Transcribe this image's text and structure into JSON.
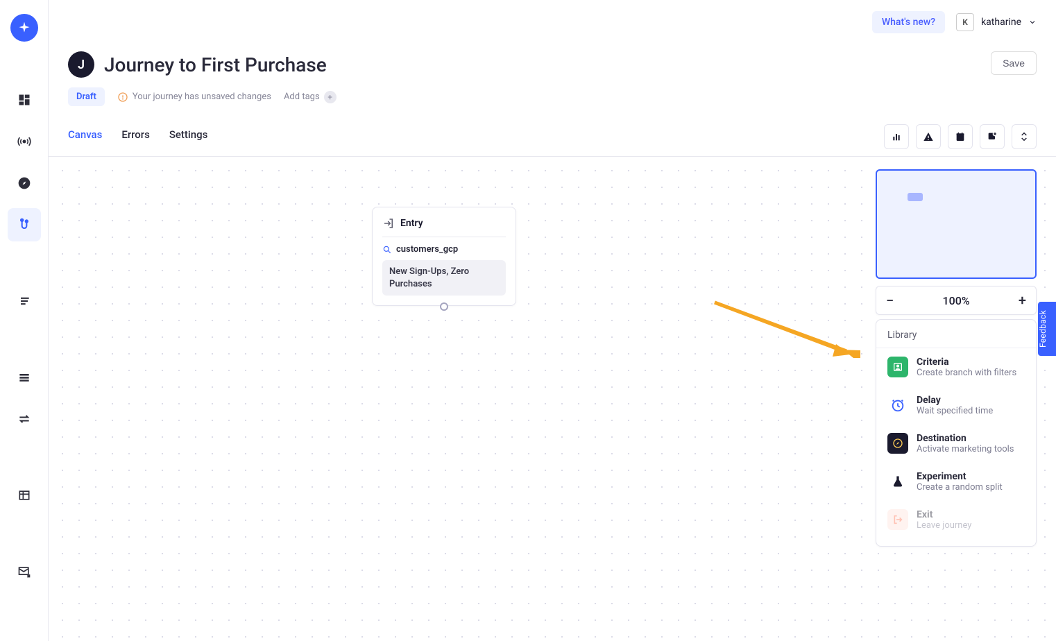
{
  "header": {
    "whats_new": "What's new?",
    "user_initial": "K",
    "user_name": "katharine"
  },
  "page": {
    "title_letter": "J",
    "title": "Journey to First Purchase",
    "save_label": "Save",
    "status": "Draft",
    "warning": "Your journey has unsaved changes",
    "add_tags": "Add tags"
  },
  "tabs": {
    "items": [
      "Canvas",
      "Errors",
      "Settings"
    ],
    "active_index": 0
  },
  "entry_node": {
    "title": "Entry",
    "source": "customers_gcp",
    "segment": "New Sign-Ups, Zero Purchases"
  },
  "zoom": {
    "value": "100%"
  },
  "library": {
    "title": "Library",
    "items": [
      {
        "name": "Criteria",
        "desc": "Create branch with filters"
      },
      {
        "name": "Delay",
        "desc": "Wait specified time"
      },
      {
        "name": "Destination",
        "desc": "Activate marketing tools"
      },
      {
        "name": "Experiment",
        "desc": "Create a random split"
      },
      {
        "name": "Exit",
        "desc": "Leave journey"
      }
    ]
  },
  "feedback_label": "Feedback"
}
